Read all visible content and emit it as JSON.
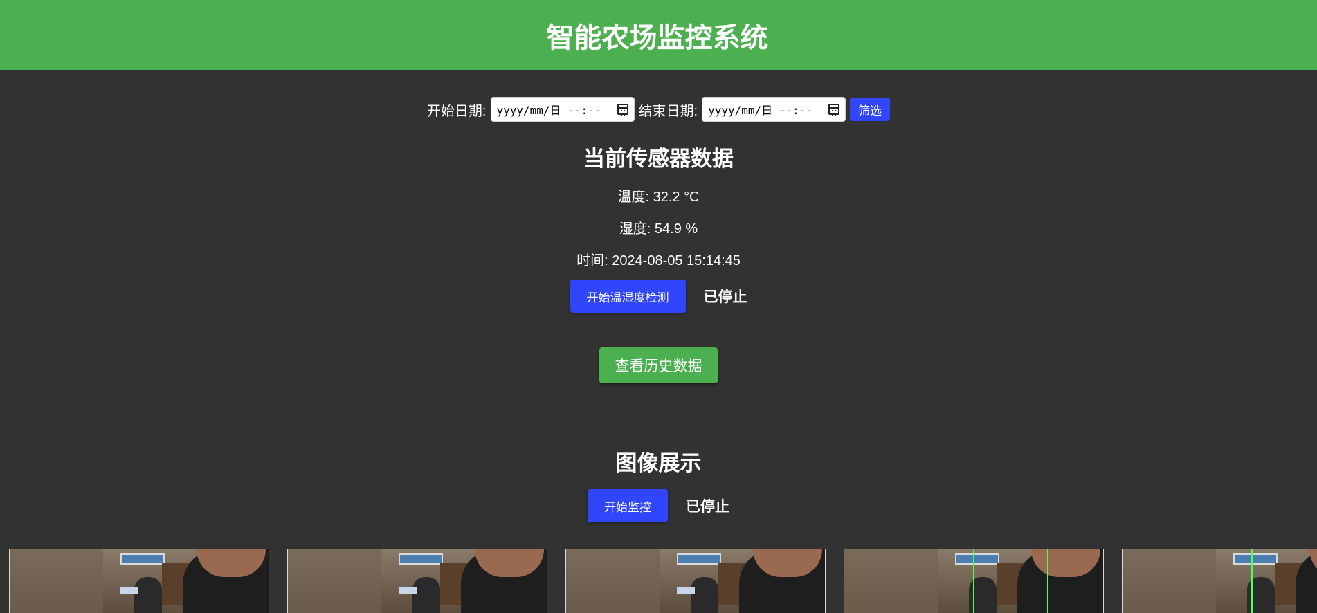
{
  "header": {
    "title": "智能农场监控系统"
  },
  "filter": {
    "start_label": "开始日期:",
    "start_value": "yyyy/mm/日 --:--",
    "end_label": "结束日期:",
    "end_value": "yyyy/mm/日 --:--",
    "filter_button": "筛选"
  },
  "sensor": {
    "title": "当前传感器数据",
    "temperature": "温度: 32.2 °C",
    "humidity": "湿度: 54.9 %",
    "time": "时间: 2024-08-05 15:14:45",
    "start_button": "开始温湿度检测",
    "status": "已停止"
  },
  "history": {
    "button": "查看历史数据"
  },
  "images": {
    "title": "图像展示",
    "start_button": "开始监控",
    "status": "已停止",
    "thumbnails": [
      "camera-frame-1",
      "camera-frame-2",
      "camera-frame-3",
      "camera-frame-4",
      "camera-frame-5"
    ]
  },
  "colors": {
    "header_bg": "#4caf50",
    "page_bg": "#323232",
    "primary_blue": "#3146fa",
    "history_green": "#4caf50"
  }
}
